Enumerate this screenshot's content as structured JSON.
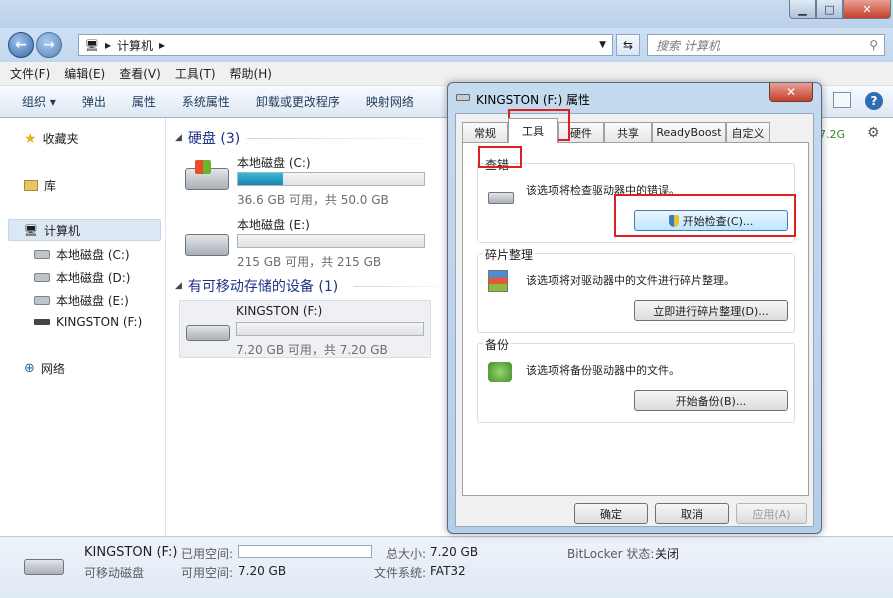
{
  "window": {
    "controls": {
      "min": "▁",
      "max": "□",
      "close": "✕"
    }
  },
  "address": {
    "breadcrumb": "计算机",
    "search_placeholder": "搜索 计算机"
  },
  "menu": [
    "文件(F)",
    "编辑(E)",
    "查看(V)",
    "工具(T)",
    "帮助(H)"
  ],
  "commands": [
    "组织 ▾",
    "弹出",
    "属性",
    "系统属性",
    "卸载或更改程序",
    "映射网络"
  ],
  "sidebar": {
    "favorites": "收藏夹",
    "libraries": "库",
    "computer": "计算机",
    "drives": [
      "本地磁盘 (C:)",
      "本地磁盘 (D:)",
      "本地磁盘 (E:)",
      "KINGSTON (F:)"
    ],
    "network": "网络"
  },
  "content": {
    "hdd_group": "硬盘 (3)",
    "removable_group": "有可移动存储的设备 (1)",
    "drives": [
      {
        "name": "本地磁盘 (C:)",
        "detail": "36.6 GB 可用，共 50.0 GB",
        "used_fraction": 0.24
      },
      {
        "name": "本地磁盘 (E:)",
        "detail": "215 GB 可用，共 215 GB",
        "used_fraction": 0.0
      },
      {
        "name": "KINGSTON (F:)",
        "detail": "7.20 GB 可用，共 7.20 GB",
        "used_fraction": 0.0
      }
    ],
    "partial_right": "7.2G"
  },
  "status": {
    "name": "KINGSTON (F:)",
    "type": "可移动磁盘",
    "used_label": "已用空间:",
    "free_label": "可用空间:",
    "free_value": "7.20 GB",
    "total_label": "总大小:",
    "total_value": "7.20 GB",
    "fs_label": "文件系统:",
    "fs_value": "FAT32",
    "bitlocker_label": "BitLocker 状态:",
    "bitlocker_value": "关闭"
  },
  "dialog": {
    "title": "KINGSTON (F:) 属性",
    "tabs": [
      "常规",
      "工具",
      "硬件",
      "共享",
      "ReadyBoost",
      "自定义"
    ],
    "check": {
      "title": "查错",
      "text": "该选项将检查驱动器中的错误。",
      "button": "开始检查(C)..."
    },
    "defrag": {
      "title": "碎片整理",
      "text": "该选项将对驱动器中的文件进行碎片整理。",
      "button": "立即进行碎片整理(D)..."
    },
    "backup": {
      "title": "备份",
      "text": "该选项将备份驱动器中的文件。",
      "button": "开始备份(B)..."
    },
    "ok": "确定",
    "cancel": "取消",
    "apply": "应用(A)"
  },
  "colors": {
    "highlight_box": "#e02020",
    "usage_fill": "#1a86b0"
  }
}
